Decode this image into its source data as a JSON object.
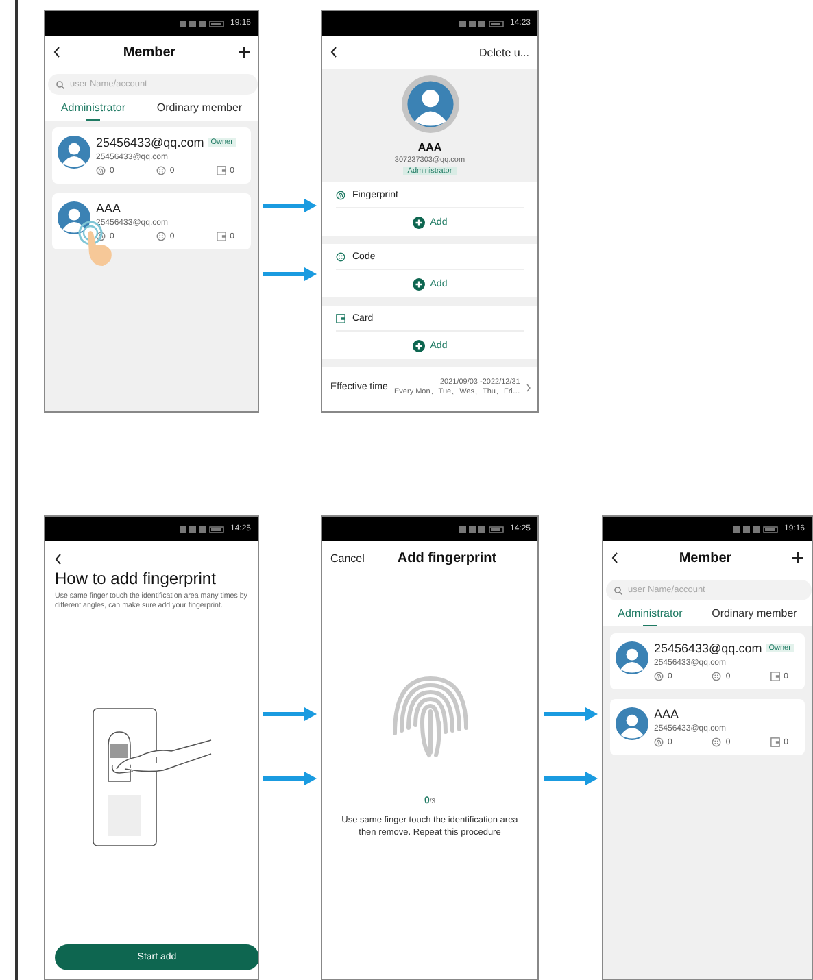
{
  "screens": [
    {
      "kind": "member_list",
      "status_time": "19:16",
      "title": "Member",
      "search_placeholder": "user Name/account",
      "tap_hint": true,
      "tabs": [
        {
          "label": "Administrator",
          "selected": true
        },
        {
          "label": "Ordinary member",
          "selected": false
        }
      ],
      "members": [
        {
          "name": "25456433@qq.com",
          "badge": "Owner",
          "account": "25456433@qq.com",
          "counts": [
            "0",
            "0",
            "0"
          ]
        },
        {
          "name": "AAA",
          "account": "25456433@qq.com",
          "counts": [
            "0",
            "0",
            "0"
          ]
        }
      ]
    },
    {
      "kind": "member_detail",
      "status_time": "14:23",
      "action": "Delete u...",
      "name": "AAA",
      "account": "307237303@qq.com",
      "role": "Administrator",
      "sections": [
        {
          "kind": "fingerprint",
          "label": "Fingerprint",
          "action": "Add"
        },
        {
          "kind": "code",
          "label": "Code",
          "action": "Add"
        },
        {
          "kind": "card",
          "label": "Card",
          "action": "Add"
        }
      ],
      "effective_time": {
        "label": "Effective time",
        "dates": "2021/09/03 -2022/12/31",
        "days": "Every Mon、Tue、Wes、Thu、Fri…"
      }
    },
    {
      "kind": "guide",
      "status_time": "14:25",
      "title": "How to add fingerprint",
      "description": "Use same finger touch the identification area many times by different angles, can make sure add your fingerprint.",
      "button": "Start add"
    },
    {
      "kind": "enroll",
      "status_time": "14:25",
      "cancel": "Cancel",
      "title": "Add fingerprint",
      "count": "0",
      "total": "/3",
      "instructions": "Use same finger touch the identification area then remove. Repeat this procedure"
    },
    {
      "kind": "member_list",
      "status_time": "19:16",
      "title": "Member",
      "search_placeholder": "user Name/account",
      "tap_hint": false,
      "tabs": [
        {
          "label": "Administrator",
          "selected": true
        },
        {
          "label": "Ordinary member",
          "selected": false
        }
      ],
      "members": [
        {
          "name": "25456433@qq.com",
          "badge": "Owner",
          "account": "25456433@qq.com",
          "counts": [
            "0",
            "0",
            "0"
          ]
        },
        {
          "name": "AAA",
          "account": "25456433@qq.com",
          "counts": [
            "0",
            "0",
            "0"
          ]
        }
      ]
    }
  ]
}
